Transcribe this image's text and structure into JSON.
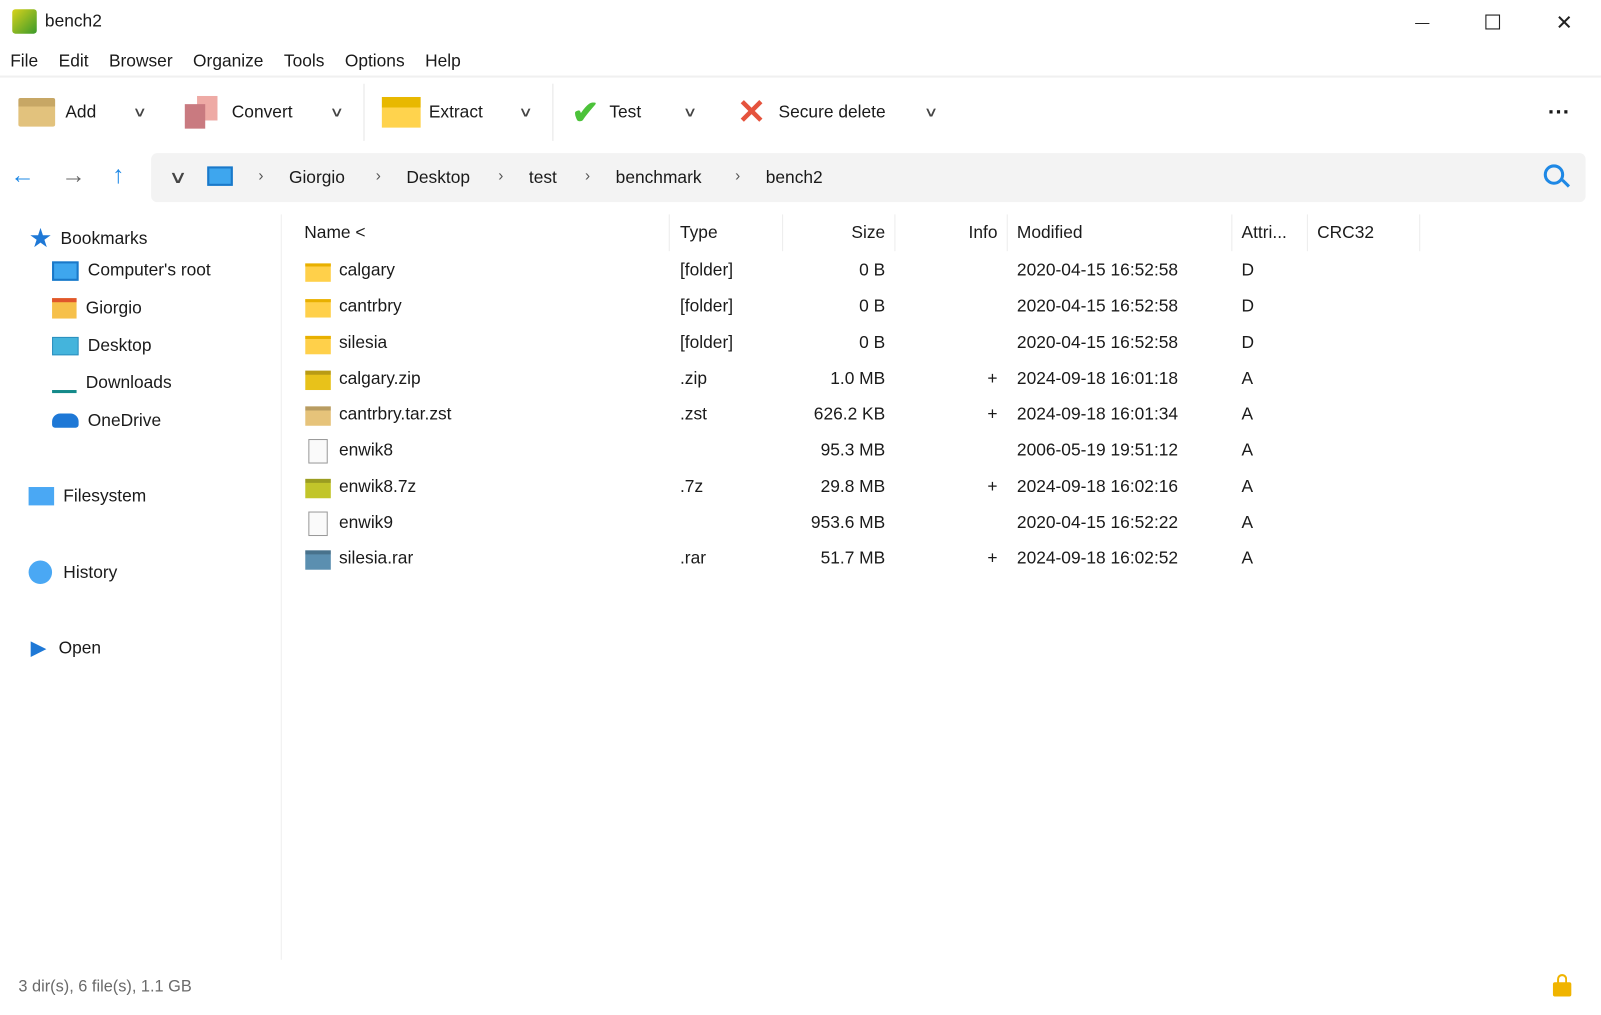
{
  "window": {
    "title": "bench2",
    "minimize": "—",
    "maximize": "☐",
    "close": "✕"
  },
  "menu": [
    "File",
    "Edit",
    "Browser",
    "Organize",
    "Tools",
    "Options",
    "Help"
  ],
  "toolbar": {
    "add": "Add",
    "convert": "Convert",
    "extract": "Extract",
    "test": "Test",
    "secure_delete": "Secure delete",
    "more": "···"
  },
  "breadcrumb": [
    "Giorgio",
    "Desktop",
    "test",
    "benchmark",
    "bench2"
  ],
  "sidebar": {
    "bookmarks": "Bookmarks",
    "items": [
      "Computer's root",
      "Giorgio",
      "Desktop",
      "Downloads",
      "OneDrive"
    ],
    "filesystem": "Filesystem",
    "history": "History",
    "open": "Open"
  },
  "columns": [
    "Name <",
    "Type",
    "Size",
    "Info",
    "Modified",
    "Attri...",
    "CRC32"
  ],
  "files": [
    {
      "name": "calgary",
      "type": "[folder]",
      "size": "0 B",
      "info": "",
      "modified": "2020-04-15 16:52:58",
      "attr": "D",
      "icon": "folder"
    },
    {
      "name": "cantrbry",
      "type": "[folder]",
      "size": "0 B",
      "info": "",
      "modified": "2020-04-15 16:52:58",
      "attr": "D",
      "icon": "folder"
    },
    {
      "name": "silesia",
      "type": "[folder]",
      "size": "0 B",
      "info": "",
      "modified": "2020-04-15 16:52:58",
      "attr": "D",
      "icon": "folder"
    },
    {
      "name": "calgary.zip",
      "type": ".zip",
      "size": "1.0 MB",
      "info": "+",
      "modified": "2024-09-18 16:01:18",
      "attr": "A",
      "icon": "zip"
    },
    {
      "name": "cantrbry.tar.zst",
      "type": ".zst",
      "size": "626.2 KB",
      "info": "+",
      "modified": "2024-09-18 16:01:34",
      "attr": "A",
      "icon": "zst"
    },
    {
      "name": "enwik8",
      "type": "",
      "size": "95.3 MB",
      "info": "",
      "modified": "2006-05-19 19:51:12",
      "attr": "A",
      "icon": "file"
    },
    {
      "name": "enwik8.7z",
      "type": ".7z",
      "size": "29.8 MB",
      "info": "+",
      "modified": "2024-09-18 16:02:16",
      "attr": "A",
      "icon": "7z"
    },
    {
      "name": "enwik9",
      "type": "",
      "size": "953.6 MB",
      "info": "",
      "modified": "2020-04-15 16:52:22",
      "attr": "A",
      "icon": "file"
    },
    {
      "name": "silesia.rar",
      "type": ".rar",
      "size": "51.7 MB",
      "info": "+",
      "modified": "2024-09-18 16:02:52",
      "attr": "A",
      "icon": "rar"
    }
  ],
  "status": "3 dir(s), 6 file(s), 1.1 GB",
  "colors": {
    "accent": "#1e88e5",
    "folder": "#ffd04a",
    "zip": "#e8c21a",
    "zst": "#e6c37a",
    "7z": "#c2c52a",
    "rar": "#5b8fb0"
  }
}
